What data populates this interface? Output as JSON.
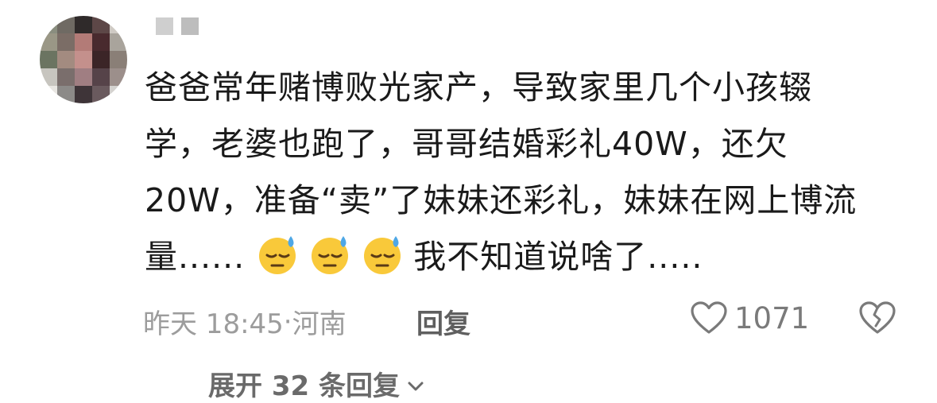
{
  "comment": {
    "author_name": "",
    "lines": [
      "爸爸常年赌博败光家产，导致家里几个小孩辍",
      "学，老婆也跑了，哥哥结婚彩礼40W，还欠",
      "20W，准备“卖”了妹妹还彩礼，妹妹在网上博流"
    ],
    "last_line_start": "量......",
    "last_line_end": "我不知道说啥了.....",
    "emoji_name": "downcast-face-with-sweat-emoji",
    "timestamp": "昨天 18:45",
    "separator": "·",
    "location": "河南",
    "reply_label": "回复",
    "like_count": "1071",
    "expand_label": "展开 32 条回复",
    "expand_icon": "chevron-down-icon"
  },
  "colors": {
    "text": "#1a1a1a",
    "meta": "#9c9c9c",
    "reply": "#5f5f5f",
    "emoji_face": "#f9c93a",
    "sweat": "#4ea7e6"
  }
}
